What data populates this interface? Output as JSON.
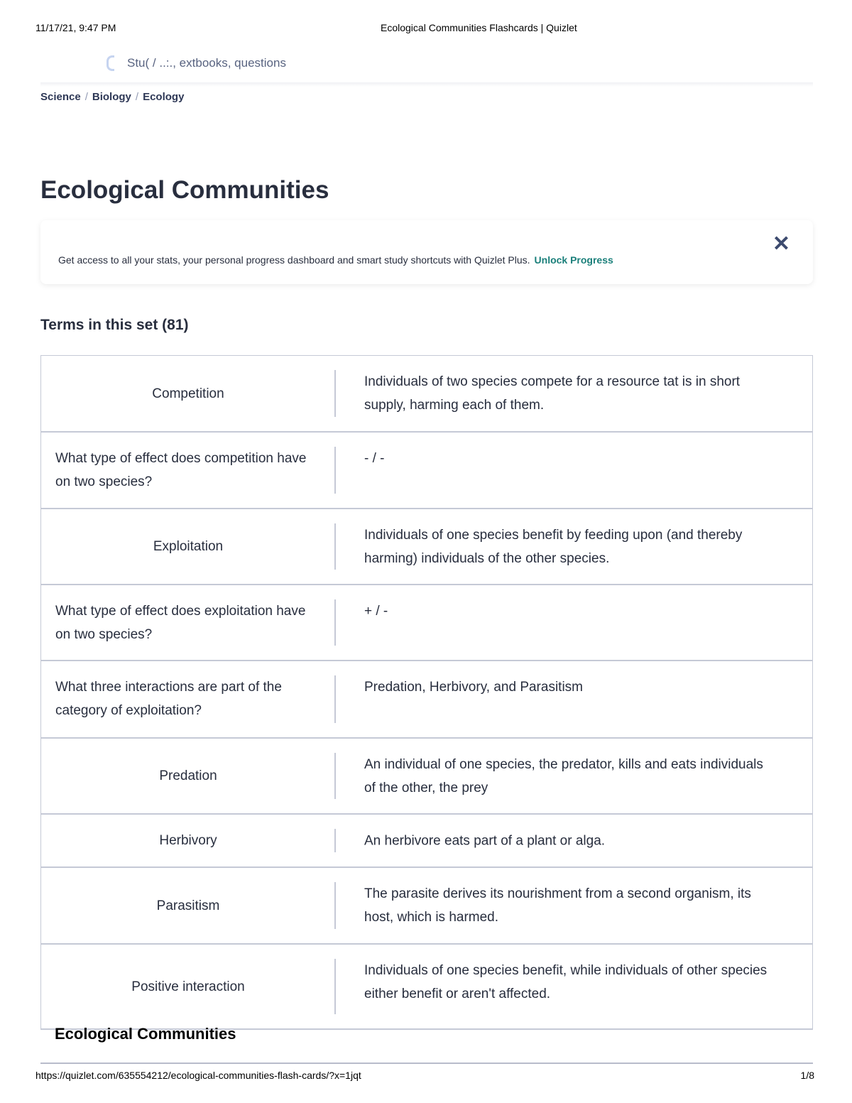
{
  "print_header": {
    "datetime": "11/17/21, 9:47 PM",
    "title": "Ecological Communities Flashcards | Quizlet"
  },
  "search": {
    "placeholder": "Study tools, textbooks, questions",
    "visible_text": "Stu( / ..:.,  extbooks, questions"
  },
  "breadcrumb": [
    "Science",
    "Biology",
    "Ecology"
  ],
  "page_title": "Ecological Communities",
  "banner": {
    "message": "Get access to all your stats, your personal progress dashboard and smart study shortcuts with Quizlet Plus.",
    "link": "Unlock Progress",
    "close_icon": "close-icon",
    "link_color": "#1a7f7a"
  },
  "terms_heading": "Terms in this set (81)",
  "cards": [
    {
      "term": "Competition",
      "definition": "Individuals of two species compete for a resource tat is in short supply, harming each of them."
    },
    {
      "term": "What type of effect does competition have on two species?",
      "definition": "- / -"
    },
    {
      "term": "Exploitation",
      "definition": "Individuals of one species benefit by feeding upon (and thereby harming) individuals of the other species."
    },
    {
      "term": "What type of effect does exploitation have on two species?",
      "definition": "+ / -"
    },
    {
      "term": "What three interactions are part of the category of exploitation?",
      "definition": "Predation, Herbivory, and Parasitism"
    },
    {
      "term": "Predation",
      "definition": "An individual of one species, the predator, kills and eats individuals of the other, the prey"
    },
    {
      "term": "Herbivory",
      "definition": "An herbivore eats part of a plant or alga."
    },
    {
      "term": "Parasitism",
      "definition": "The parasite derives its nourishment from a second organism, its host, which is harmed."
    },
    {
      "term": "Positive interaction",
      "definition": "Individuals of one species benefit, while individuals of other species either benefit or aren't affected."
    }
  ],
  "footer": {
    "set_title": "Ecological Communities",
    "url": "https://quizlet.com/635554212/ecological-communities-flash-cards/?x=1jqt",
    "page": "1/8"
  }
}
